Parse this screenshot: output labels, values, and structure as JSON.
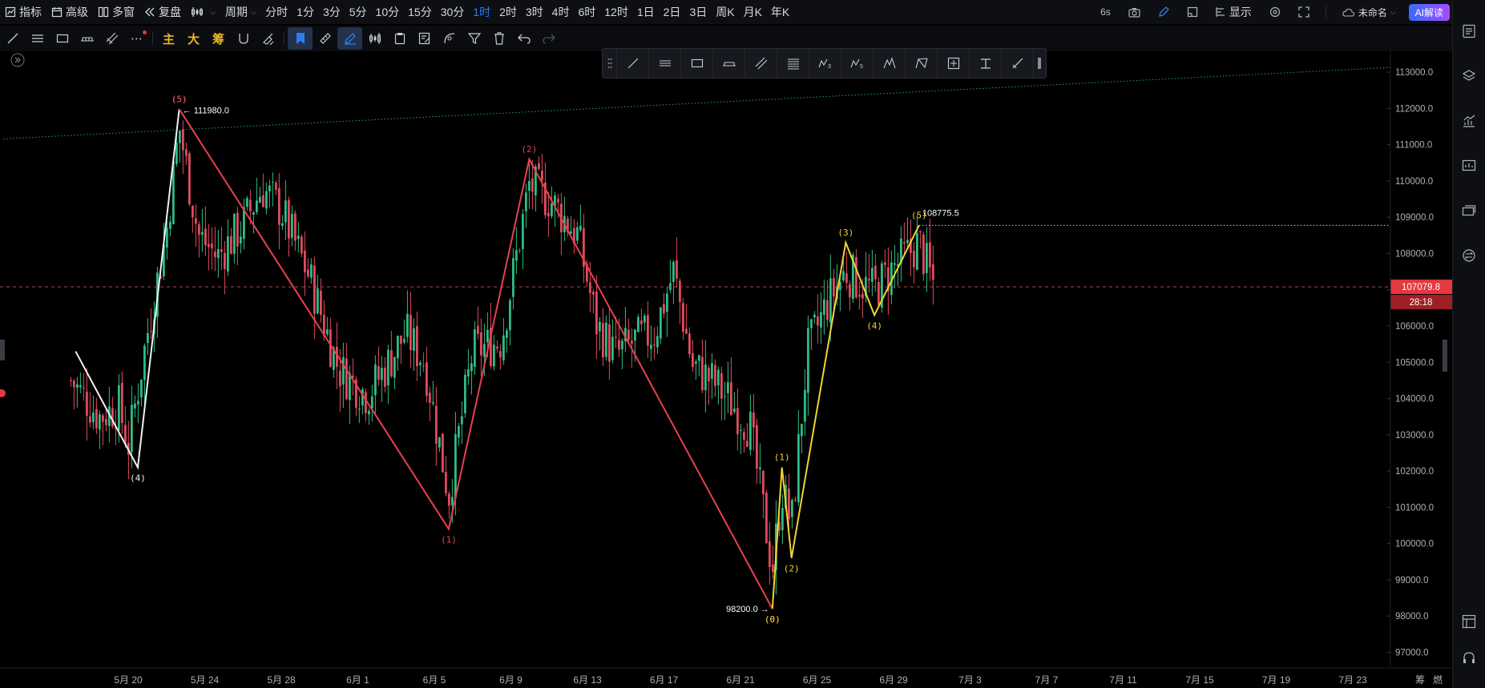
{
  "topbar": {
    "left": [
      {
        "label": "指标",
        "icon": "indicator-icon"
      },
      {
        "label": "高级",
        "icon": "calendar-icon"
      },
      {
        "label": "多窗",
        "icon": "grid-icon"
      },
      {
        "label": "复盘",
        "icon": "replay-icon"
      },
      {
        "label": "",
        "icon": "chart-type-icon"
      },
      {
        "label": "周期",
        "icon": ""
      }
    ],
    "periods": [
      "分时",
      "1分",
      "3分",
      "5分",
      "10分",
      "15分",
      "30分",
      "1时",
      "2时",
      "3时",
      "4时",
      "6时",
      "12时",
      "1日",
      "2日",
      "3日",
      "周K",
      "月K",
      "年K"
    ],
    "active_period": "1时",
    "right": {
      "interval_badge": "6s",
      "display_label": "显示",
      "name_label": "未命名",
      "ai_label": "AI解读"
    }
  },
  "toolbar2": {
    "main_label": "主",
    "big_label": "大",
    "chip_label": "筹"
  },
  "chart_data": {
    "type": "candlestick",
    "price_axis_ticks": [
      "113000.0",
      "112000.0",
      "111000.0",
      "110000.0",
      "109000.0",
      "108000.0",
      "107000.0",
      "106000.0",
      "105000.0",
      "104000.0",
      "103000.0",
      "102000.0",
      "101000.0",
      "100000.0",
      "99000.0",
      "98000.0",
      "97000.0"
    ],
    "date_axis_ticks": [
      "5月 20",
      "5月 24",
      "5月 28",
      "6月 1",
      "6月 5",
      "6月 9",
      "6月 13",
      "6月 17",
      "6月 21",
      "6月 25",
      "6月 29",
      "7月 3",
      "7月 7",
      "7月 11",
      "7月 15",
      "7月 19",
      "7月 23"
    ],
    "ylim": [
      96700,
      113400
    ],
    "current_price": "107079.8",
    "countdown": "28:18",
    "price_labels": {
      "high": "111980.0",
      "low": "98200.0",
      "wave5": "108775.5"
    },
    "axis_corner_labels": [
      "筹",
      "燃"
    ],
    "white_wave": [
      {
        "date": "5/17 06:00",
        "price": 105300,
        "label": ""
      },
      {
        "date": "5/20 12:00",
        "price": 102100,
        "label": "(4)"
      },
      {
        "date": "5/22 16:00",
        "price": 111980,
        "label": "(5)"
      }
    ],
    "red_wave": [
      {
        "date": "5/22 16:00",
        "price": 111980,
        "label": "(5)"
      },
      {
        "date": "6/5 18:00",
        "price": 100400,
        "label": "(1)"
      },
      {
        "date": "6/9 23:00",
        "price": 110600,
        "label": "(2)"
      },
      {
        "date": "6/22 16:00",
        "price": 98200,
        "label": "(0)"
      }
    ],
    "yellow_wave": [
      {
        "date": "6/22 16:00",
        "price": 98200,
        "label": "(0)"
      },
      {
        "date": "6/23 04:00",
        "price": 102100,
        "label": "(1)"
      },
      {
        "date": "6/23 16:00",
        "price": 99600,
        "label": "(2)"
      },
      {
        "date": "6/26 12:00",
        "price": 108300,
        "label": "(3)"
      },
      {
        "date": "6/28 00:00",
        "price": 106300,
        "label": "(4)"
      },
      {
        "date": "6/30 08:00",
        "price": 108775.5,
        "label": "(5)"
      }
    ],
    "candle_anchors": [
      {
        "date": "5/17 00:00",
        "price": 104500
      },
      {
        "date": "5/18 12:00",
        "price": 103500
      },
      {
        "date": "5/19 12:00",
        "price": 103800
      },
      {
        "date": "5/20 00:00",
        "price": 102700
      },
      {
        "date": "5/21 00:00",
        "price": 105800
      },
      {
        "date": "5/22 00:00",
        "price": 108600
      },
      {
        "date": "5/22 16:00",
        "price": 111500
      },
      {
        "date": "5/23 16:00",
        "price": 108500
      },
      {
        "date": "5/24 16:00",
        "price": 107900
      },
      {
        "date": "5/26 00:00",
        "price": 108800
      },
      {
        "date": "5/27 00:00",
        "price": 109800
      },
      {
        "date": "5/28 00:00",
        "price": 109200
      },
      {
        "date": "5/29 12:00",
        "price": 107300
      },
      {
        "date": "5/31 00:00",
        "price": 104800
      },
      {
        "date": "6/1 12:00",
        "price": 104100
      },
      {
        "date": "6/2 12:00",
        "price": 104900
      },
      {
        "date": "6/3 12:00",
        "price": 105800
      },
      {
        "date": "6/4 12:00",
        "price": 105000
      },
      {
        "date": "6/5 18:00",
        "price": 101300
      },
      {
        "date": "6/7 00:00",
        "price": 105300
      },
      {
        "date": "6/8 12:00",
        "price": 105600
      },
      {
        "date": "6/9 23:00",
        "price": 109900
      },
      {
        "date": "6/11 00:00",
        "price": 109500
      },
      {
        "date": "6/12 12:00",
        "price": 108500
      },
      {
        "date": "6/13 12:00",
        "price": 106000
      },
      {
        "date": "6/14 12:00",
        "price": 105200
      },
      {
        "date": "6/15 12:00",
        "price": 105600
      },
      {
        "date": "6/16 12:00",
        "price": 105800
      },
      {
        "date": "6/17 12:00",
        "price": 107500
      },
      {
        "date": "6/18 12:00",
        "price": 104900
      },
      {
        "date": "6/19 12:00",
        "price": 104500
      },
      {
        "date": "6/20 12:00",
        "price": 103900
      },
      {
        "date": "6/21 12:00",
        "price": 103200
      },
      {
        "date": "6/22 16:00",
        "price": 99300
      },
      {
        "date": "6/23 04:00",
        "price": 101500
      },
      {
        "date": "6/23 16:00",
        "price": 100500
      },
      {
        "date": "6/24 12:00",
        "price": 105300
      },
      {
        "date": "6/25 12:00",
        "price": 106600
      },
      {
        "date": "6/26 12:00",
        "price": 107500
      },
      {
        "date": "6/27 12:00",
        "price": 107100
      },
      {
        "date": "6/28 00:00",
        "price": 107000
      },
      {
        "date": "6/29 00:00",
        "price": 107600
      },
      {
        "date": "6/30 08:00",
        "price": 108300
      },
      {
        "date": "6/30 20:00",
        "price": 107500
      },
      {
        "date": "7/1 04:00",
        "price": 107079.8
      }
    ]
  }
}
